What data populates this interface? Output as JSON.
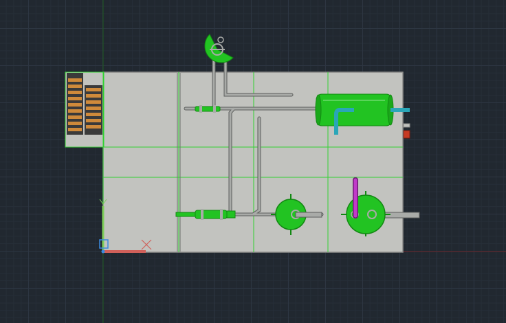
{
  "viewport": {
    "background": "#212830",
    "grid_major": "#2d3642",
    "grid_minor": "#262e38",
    "axis_x_color": "#6b2226",
    "axis_y_color": "#1f5a22"
  },
  "colors": {
    "floor": "#c2c3bf",
    "floor_border": "#8a8a88",
    "column_grid": "#31d231",
    "equipment": "#22c322",
    "equipment_dark": "#128812",
    "pipe": "#a9aba8",
    "pipe_outline": "#5c5e5c",
    "cooling_pipe": "#2aa6b8",
    "hot_pipe": "#c13ac9",
    "terminal": "#c63a24",
    "rack": "#cf8a3a",
    "ucs_x": "#d0605a",
    "ucs_y": "#7fcf5a",
    "ucs_z": "#3a8ae0"
  },
  "equipment": [
    {
      "name": "rotary-valve",
      "icon": "green-disc-with-sector-cutout"
    },
    {
      "name": "storage-rack",
      "icon": "orange-shelving-blocks"
    },
    {
      "name": "horizontal-tank",
      "icon": "green-cylinder"
    },
    {
      "name": "inline-filter-top",
      "icon": "green-inline-cylinder"
    },
    {
      "name": "inline-filter-bottom",
      "icon": "green-inline-cylinder"
    },
    {
      "name": "pump-1",
      "icon": "green-disc-with-crosshair"
    },
    {
      "name": "pump-2",
      "icon": "green-disc-with-crosshair"
    },
    {
      "name": "heater-element",
      "icon": "purple-u-tube"
    },
    {
      "name": "terminal-box",
      "icon": "red-rectangle"
    }
  ],
  "ucs_icon": {
    "axes": [
      "X",
      "Y"
    ],
    "origin_marker": "square"
  }
}
